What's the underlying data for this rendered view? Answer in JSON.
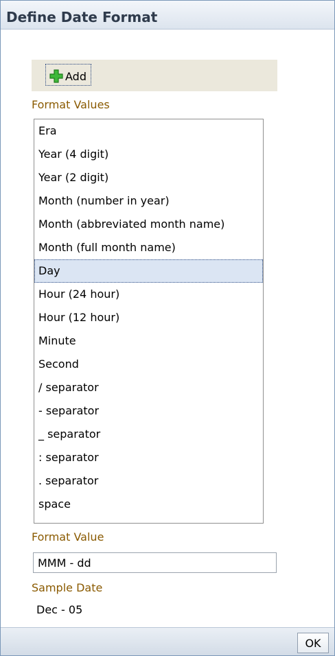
{
  "dialog": {
    "title": "Define Date Format"
  },
  "toolbar": {
    "add_label": "Add",
    "add_icon": "plus-icon"
  },
  "format_values": {
    "label": "Format Values",
    "items": [
      "Era",
      "Year (4 digit)",
      "Year (2 digit)",
      "Month (number in year)",
      "Month (abbreviated month name)",
      "Month (full month name)",
      "Day",
      "Hour (24 hour)",
      "Hour (12 hour)",
      "Minute",
      "Second",
      "/ separator",
      "- separator",
      "_ separator",
      ": separator",
      ". separator",
      "space"
    ],
    "selected": "Day"
  },
  "format_value": {
    "label": "Format Value",
    "value": "MMM - dd"
  },
  "sample_date": {
    "label": "Sample Date",
    "value": "Dec - 05"
  },
  "footer": {
    "ok_label": "OK"
  },
  "colors": {
    "label_orange": "#8a5a00",
    "selection_bg": "#dbe5f3",
    "toolbar_bg": "#ebe8dc"
  }
}
